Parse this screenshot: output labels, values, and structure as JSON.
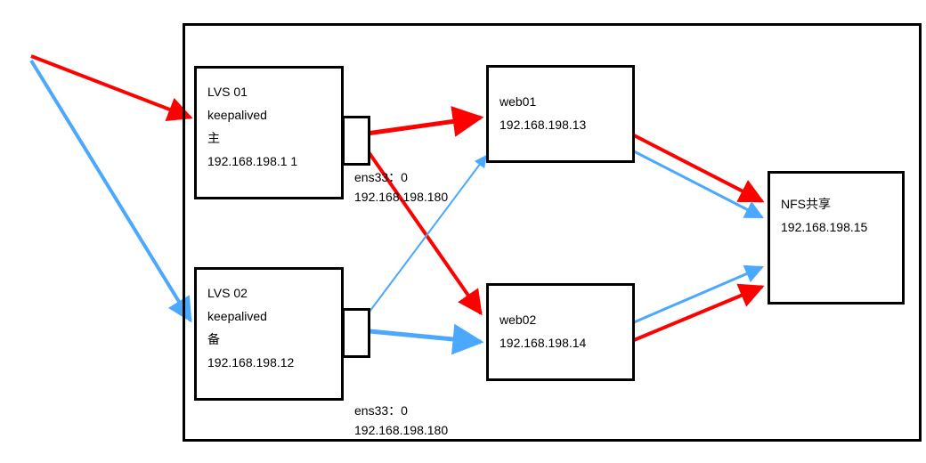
{
  "diagram": {
    "lvs01": {
      "line1": "LVS  01",
      "line2": "keepalived",
      "line3": "主",
      "line4": "192.168.198.1 1"
    },
    "lvs02": {
      "line1": "LVS 02",
      "line2": "keepalived",
      "line3": "备",
      "line4": "192.168.198.12"
    },
    "ens33_top": {
      "line1": "ens33：0",
      "line2": "192.168.198.180"
    },
    "ens33_bottom": {
      "line1": "ens33：0",
      "line2": "192.168.198.180"
    },
    "web01": {
      "line1": "web01",
      "line2": "192.168.198.13"
    },
    "web02": {
      "line1": "web02",
      "line2": "192.168.198.14"
    },
    "nfs": {
      "line1": "NFS共享",
      "line2": "192.168.198.15"
    },
    "colors": {
      "red": "#ff0000",
      "blue": "#4aa8ff"
    }
  }
}
